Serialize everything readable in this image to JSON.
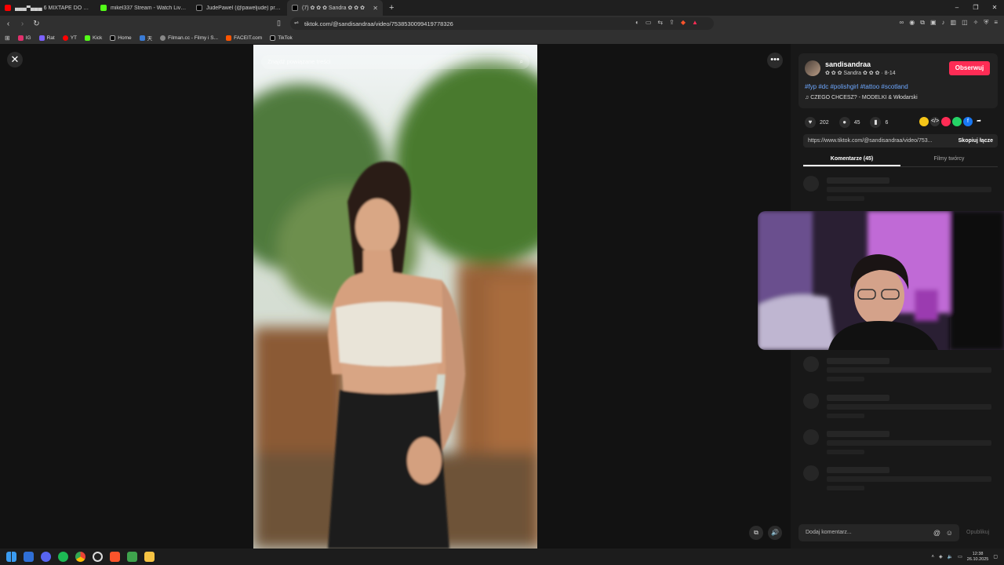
{
  "browser": {
    "tabs": [
      {
        "title": "▄▄▄▀▄▄▄ 6 MIXTAPE DO OT!",
        "color": "#ff0000",
        "active": false
      },
      {
        "title": "mikel337 Stream - Watch Live on Ki",
        "color": "#53fc18",
        "active": false
      },
      {
        "title": "JudePawel (@paweljude) prowad",
        "color": "#ffffff",
        "active": false
      },
      {
        "title": "(7) ✿ ✿ ✿ Sandra ✿ ✿ ✿",
        "color": "#ffffff",
        "active": true
      }
    ],
    "new_tab": "+",
    "url": "tiktok.com/@sandisandraa/video/7538530099419778326",
    "bookmarks": [
      {
        "label": "IG",
        "color": "#e1306c"
      },
      {
        "label": "Rat",
        "color": "#7b61ff"
      },
      {
        "label": "YT",
        "color": "#ff0000"
      },
      {
        "label": "Kick",
        "color": "#53fc18"
      },
      {
        "label": "Home",
        "color": "#ffffff"
      },
      {
        "label": "天",
        "color": "#3a7bd5"
      },
      {
        "label": "Filman.cc - Filmy i S...",
        "color": "#888888"
      },
      {
        "label": "FACEIT.com",
        "color": "#ff5500"
      },
      {
        "label": "TikTok",
        "color": "#ffffff"
      }
    ]
  },
  "tiktok": {
    "search_placeholder": "Znajdź powiązane treści",
    "author": {
      "username": "sandisandraa",
      "display": "✿ ✿ ✿ Sandra ✿ ✿ ✿ · 8-14",
      "follow_label": "Obserwuj"
    },
    "hashtags": "#fyp #dc #polishgirl #tattoo #scotland",
    "music": "♫  CZEGO CHCESZ? - MODELKI & Włodarski",
    "stats": {
      "likes": "202",
      "comments": "45",
      "saves": "6"
    },
    "link": "https://www.tiktok.com/@sandisandraa/video/753...",
    "copy_label": "Skopiuj łącze",
    "tabs": {
      "comments": "Komentarze (45)",
      "creator_videos": "Filmy twórcy"
    },
    "comment_placeholder": "Dodaj komentarz...",
    "publish_label": "Opublikuj"
  },
  "taskbar": {
    "time": "12:38",
    "date": "26.10.2025"
  }
}
